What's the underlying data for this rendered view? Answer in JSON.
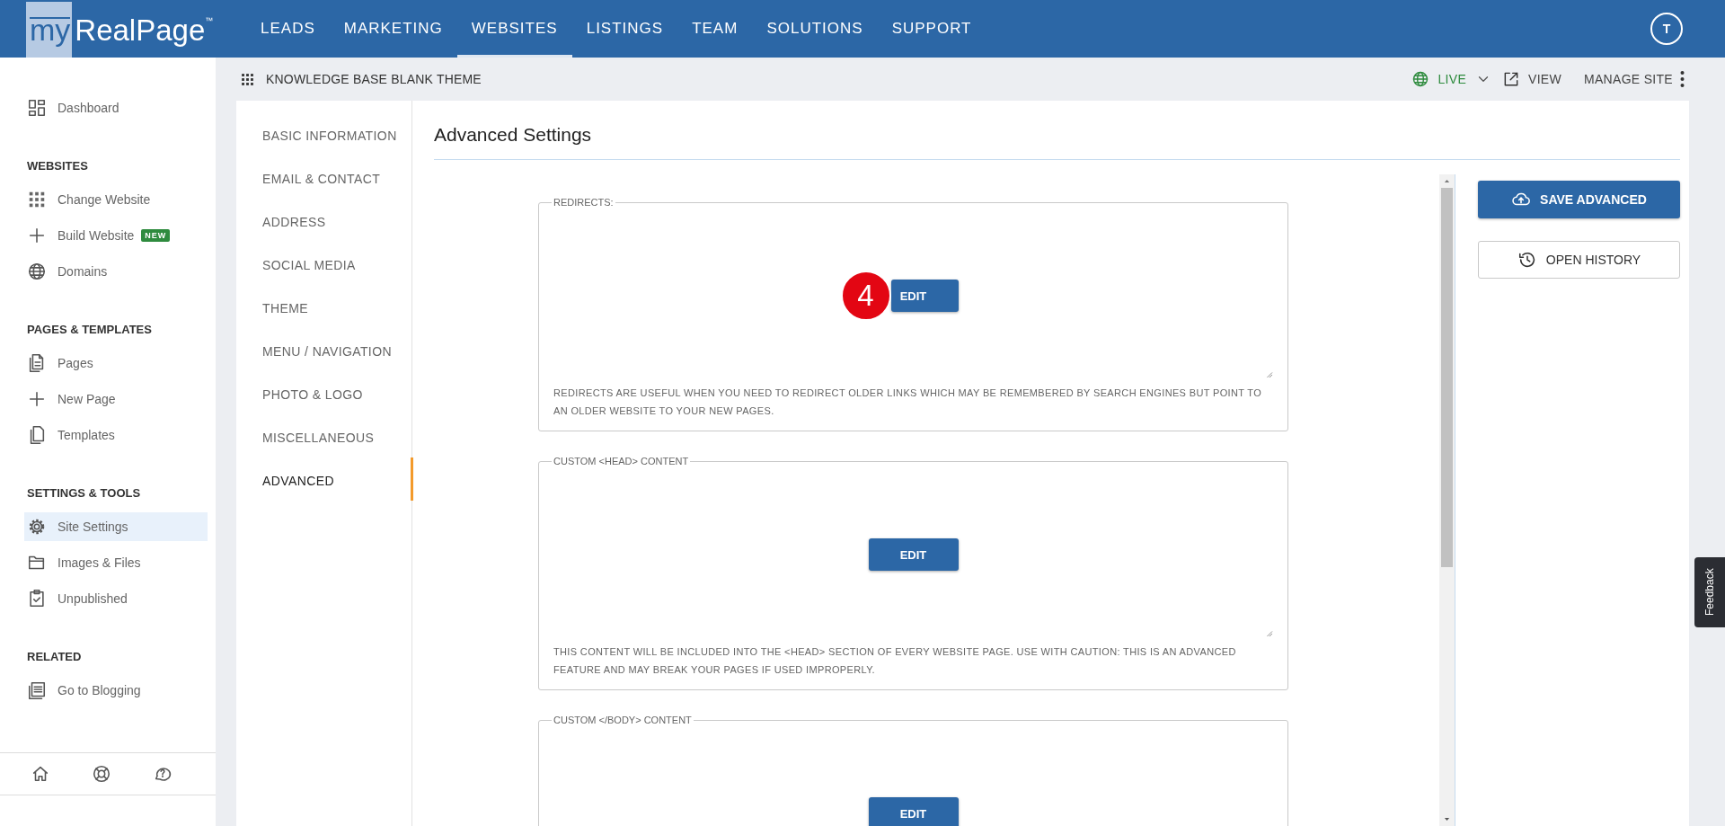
{
  "logo": {
    "prefix": "my",
    "name": "RealPage",
    "mark": "™"
  },
  "nav": [
    {
      "label": "LEADS",
      "selected": false
    },
    {
      "label": "MARKETING",
      "selected": false
    },
    {
      "label": "WEBSITES",
      "selected": true
    },
    {
      "label": "LISTINGS",
      "selected": false
    },
    {
      "label": "TEAM",
      "selected": false
    },
    {
      "label": "SOLUTIONS",
      "selected": false
    },
    {
      "label": "SUPPORT",
      "selected": false
    }
  ],
  "user": {
    "initial": "T"
  },
  "site_bar": {
    "title": "KNOWLEDGE BASE BLANK THEME",
    "status": "LIVE",
    "view": "VIEW",
    "manage": "MANAGE SITE"
  },
  "sidebar": {
    "groups": [
      {
        "items": [
          {
            "label": "Dashboard",
            "selected": false
          }
        ]
      },
      {
        "heading": "WEBSITES",
        "items": [
          {
            "label": "Change Website",
            "selected": false
          },
          {
            "label": "Build Website",
            "selected": false,
            "badge": "NEW"
          },
          {
            "label": "Domains",
            "selected": false
          }
        ]
      },
      {
        "heading": "PAGES & TEMPLATES",
        "items": [
          {
            "label": "Pages",
            "selected": false
          },
          {
            "label": "New Page",
            "selected": false
          },
          {
            "label": "Templates",
            "selected": false
          }
        ]
      },
      {
        "heading": "SETTINGS & TOOLS",
        "items": [
          {
            "label": "Site Settings",
            "selected": true
          },
          {
            "label": "Images & Files",
            "selected": false
          },
          {
            "label": "Unpublished",
            "selected": false
          }
        ]
      },
      {
        "heading": "RELATED",
        "items": [
          {
            "label": "Go to Blogging",
            "selected": false
          }
        ]
      }
    ]
  },
  "settings_nav": [
    {
      "label": "BASIC INFORMATION",
      "selected": false
    },
    {
      "label": "EMAIL & CONTACT",
      "selected": false
    },
    {
      "label": "ADDRESS",
      "selected": false
    },
    {
      "label": "SOCIAL MEDIA",
      "selected": false
    },
    {
      "label": "THEME",
      "selected": false
    },
    {
      "label": "MENU / NAVIGATION",
      "selected": false
    },
    {
      "label": "PHOTO & LOGO",
      "selected": false
    },
    {
      "label": "MISCELLANEOUS",
      "selected": false
    },
    {
      "label": "ADVANCED",
      "selected": true
    }
  ],
  "page_title": "Advanced Settings",
  "fields": [
    {
      "legend": "REDIRECTS:",
      "button": "EDIT",
      "step_badge": "4",
      "help": "REDIRECTS ARE USEFUL WHEN YOU NEED TO REDIRECT OLDER LINKS WHICH MAY BE REMEMBERED BY SEARCH ENGINES BUT POINT TO AN OLDER WEBSITE TO YOUR NEW PAGES."
    },
    {
      "legend": "CUSTOM <HEAD> CONTENT",
      "button": "EDIT",
      "help": "THIS CONTENT WILL BE INCLUDED INTO THE <HEAD> SECTION OF EVERY WEBSITE PAGE. USE WITH CAUTION: THIS IS AN ADVANCED FEATURE AND MAY BREAK YOUR PAGES IF USED IMPROPERLY."
    },
    {
      "legend": "CUSTOM </BODY> CONTENT",
      "button": "EDIT"
    }
  ],
  "actions": [
    {
      "label": "SAVE ADVANCED",
      "kind": "primary"
    },
    {
      "label": "OPEN HISTORY",
      "kind": "secondary"
    }
  ],
  "feedback": "Feedback"
}
